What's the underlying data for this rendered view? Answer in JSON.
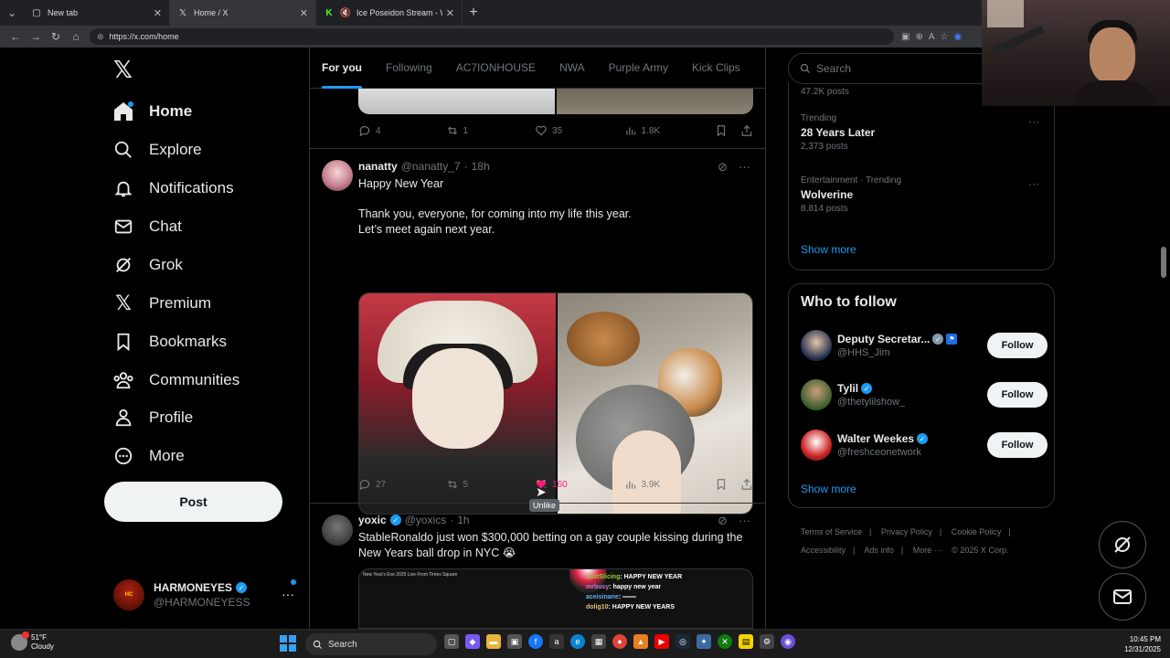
{
  "browser": {
    "tabs": [
      {
        "title": "New tab",
        "close": "✕"
      },
      {
        "title": "Home / X",
        "close": "✕"
      },
      {
        "title": "Ice Poseidon Stream - Watch",
        "close": "✕"
      }
    ],
    "new_tab": "+",
    "url": "https://x.com/home"
  },
  "nav": {
    "items": [
      {
        "label": "Home",
        "icon": "home-icon"
      },
      {
        "label": "Explore",
        "icon": "search-icon"
      },
      {
        "label": "Notifications",
        "icon": "bell-icon"
      },
      {
        "label": "Chat",
        "icon": "mail-icon"
      },
      {
        "label": "Grok",
        "icon": "grok-icon"
      },
      {
        "label": "Premium",
        "icon": "x-logo-icon"
      },
      {
        "label": "Bookmarks",
        "icon": "bookmark-icon"
      },
      {
        "label": "Communities",
        "icon": "people-icon"
      },
      {
        "label": "Profile",
        "icon": "person-icon"
      },
      {
        "label": "More",
        "icon": "more-circle-icon"
      }
    ],
    "post_label": "Post",
    "account": {
      "name": "HARMONEYES",
      "handle": "@HARMONEYESS",
      "more": "···"
    }
  },
  "feed": {
    "tabs": [
      "For you",
      "Following",
      "AC7IONHOUSE",
      "NWA",
      "Purple Army",
      "Kick Clips"
    ],
    "prev_post_actions": {
      "replies": "4",
      "reposts": "1",
      "likes": "35",
      "views": "1.8K"
    },
    "post1": {
      "name": "nanatty",
      "handle": "@nanatty_7",
      "sep": "·",
      "time": "18h",
      "line1": "Happy New Year",
      "line2": "Thank you, everyone, for coming into my life this year.",
      "line3": "Let’s meet again next year.",
      "actions": {
        "replies": "27",
        "reposts": "5",
        "likes": "160",
        "views": "3.9K"
      },
      "tooltip": "Unlike"
    },
    "post2": {
      "name": "yoxic",
      "handle": "@yoxics",
      "sep": "·",
      "time": "1h",
      "text": "StableRonaldo just won $300,000 betting on a gay couple kissing during the New Years ball drop in NYC 😭",
      "media_caption": "New Year's Eve 2025 Live From Times Square",
      "chat": [
        {
          "user": "JustSlicing",
          "msg": ": HAPPY NEW YEAR"
        },
        {
          "user": "mrbusy",
          "msg": ": happy new year"
        },
        {
          "user": "aceisinane",
          "msg": ": ═══"
        },
        {
          "user": "dolig10",
          "msg": ": HAPPY NEW YEARS"
        }
      ]
    }
  },
  "right": {
    "search_placeholder": "Search",
    "trend0_count": "47.2K posts",
    "trends": [
      {
        "category": "Trending",
        "title": "28 Years Later",
        "count": "2,373 posts"
      },
      {
        "category": "Entertainment · Trending",
        "title": "Wolverine",
        "count": "8,814 posts"
      }
    ],
    "show_more": "Show more",
    "who_to_follow": {
      "title": "Who to follow",
      "people": [
        {
          "name": "Deputy Secretar...",
          "handle": "@HHS_Jim"
        },
        {
          "name": "Tylil",
          "handle": "@thetylilshow_"
        },
        {
          "name": "Walter Weekes",
          "handle": "@freshceonetwork"
        }
      ],
      "follow_label": "Follow",
      "show_more": "Show more"
    },
    "footer": [
      "Terms of Service",
      "|",
      "Privacy Policy",
      "|",
      "Cookie Policy",
      "|",
      "Accessibility",
      "|",
      "Ads info",
      "|",
      "More ···",
      "© 2025 X Corp."
    ]
  },
  "taskbar": {
    "temp": "51°F",
    "condition": "Cloudy",
    "search": "Search",
    "time": "10:45 PM",
    "date": "12/31/2025"
  },
  "colors": {
    "accent": "#1d9bf0",
    "like": "#f91880",
    "bg": "#000000",
    "muted": "#71767b"
  }
}
